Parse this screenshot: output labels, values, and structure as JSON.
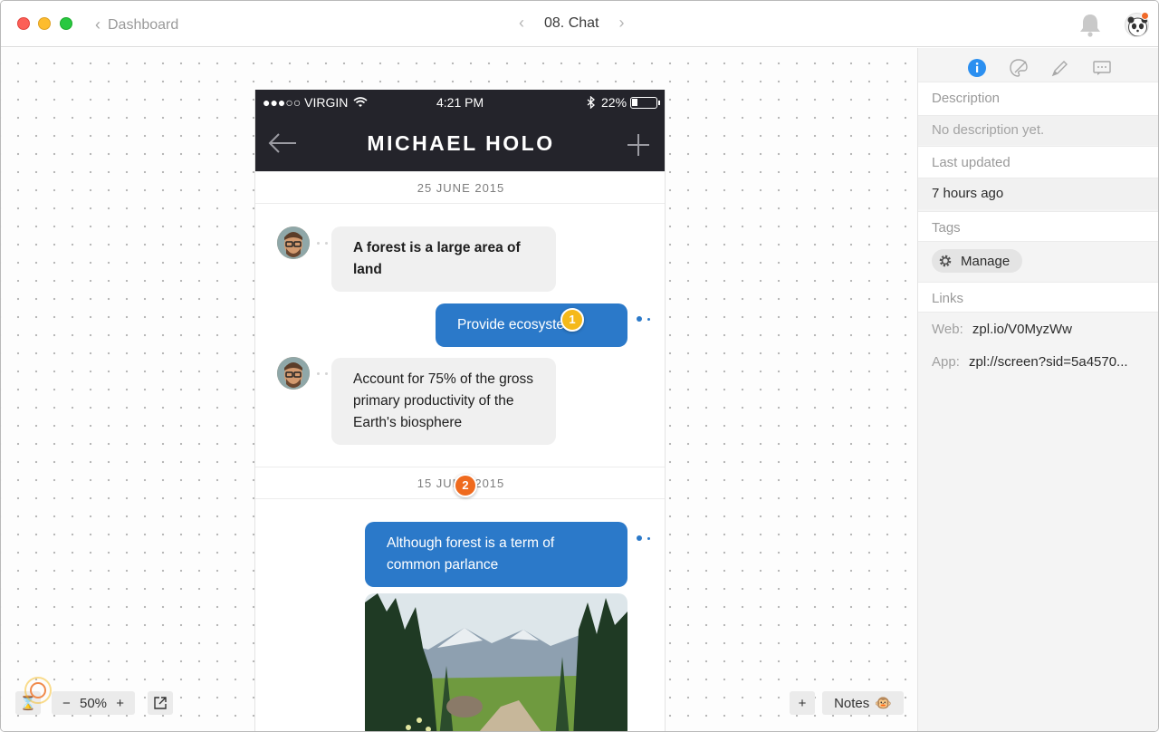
{
  "window": {
    "back_label": "Dashboard",
    "screen_title": "08. Chat"
  },
  "phone": {
    "status": {
      "carrier": "●●●○○ VIRGIN",
      "time": "4:21 PM",
      "battery": "22%",
      "battery_level": 0.22
    },
    "contact_name": "MICHAEL HOLO",
    "dates": [
      "25 JUNE 2015",
      "15 JUNE 2015"
    ],
    "messages": [
      {
        "direction": "in",
        "text": "A forest is a large area of land",
        "bold": true
      },
      {
        "direction": "out",
        "text": "Provide ecosystem"
      },
      {
        "direction": "in",
        "text": "Account for 75% of the gross primary productivity of the Earth's biosphere"
      },
      {
        "direction": "out",
        "text": "Although forest is a term of common parlance"
      }
    ],
    "photo_icon": "forest-photo"
  },
  "hotspots": [
    "1",
    "2"
  ],
  "toolbar": {
    "zoom": "50%",
    "zoom_out": "−",
    "zoom_in": "+",
    "add_label": "+",
    "notes_label": "Notes",
    "notes_emoji": "🐵"
  },
  "sidebar": {
    "description_label": "Description",
    "description_value": "No description yet.",
    "updated_label": "Last updated",
    "updated_value": "7 hours ago",
    "tags_label": "Tags",
    "manage_label": "Manage",
    "links_label": "Links",
    "web_key": "Web:",
    "web_value": "zpl.io/V0MyzWw",
    "app_key": "App:",
    "app_value": "zpl://screen?sid=5a4570..."
  },
  "colors": {
    "accent_blue": "#2b79c9",
    "header_dark": "#24242b",
    "hotspot_yellow": "#f5b91a",
    "hotspot_orange": "#ef6a1e",
    "info_blue": "#2b8ff0"
  }
}
